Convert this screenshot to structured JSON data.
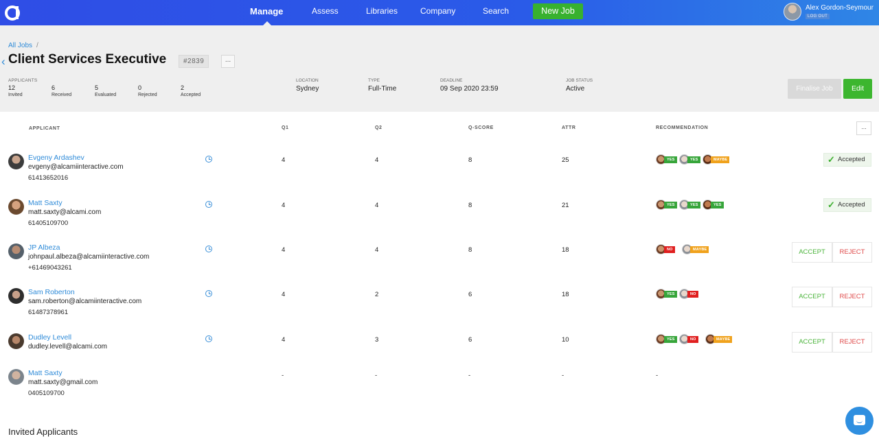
{
  "topbar": {
    "logo_icon": "alcami-logo-icon",
    "nav": [
      "Manage",
      "Assess",
      "Libraries",
      "Company",
      "Search"
    ],
    "active_nav": "Manage",
    "new_job_label": "New Job",
    "user_name": "Alex Gordon-Seymour",
    "logout_label": "LOG OUT"
  },
  "job": {
    "breadcrumb_root": "All Jobs",
    "breadcrumb_sep": "/",
    "title": "Client Services Executive",
    "id": "#2839",
    "more_label": "...",
    "applicants_label": "APPLICANTS",
    "stats": [
      {
        "n": "12",
        "label": "Invited"
      },
      {
        "n": "6",
        "label": "Received"
      },
      {
        "n": "5",
        "label": "Evaluated"
      },
      {
        "n": "0",
        "label": "Rejected"
      },
      {
        "n": "2",
        "label": "Accepted"
      }
    ],
    "meta": [
      {
        "label": "LOCATION",
        "value": "Sydney"
      },
      {
        "label": "TYPE",
        "value": "Full-Time"
      },
      {
        "label": "DEADLINE",
        "value": "09 Sep 2020 23:59"
      },
      {
        "label": "JOB STATUS",
        "value": "Active"
      }
    ],
    "finalise_label": "Finalise Job",
    "edit_label": "Edit"
  },
  "table": {
    "headers": {
      "applicant": "APPLICANT",
      "q1": "Q1",
      "q2": "Q2",
      "qscore": "Q-SCORE",
      "attr": "ATTR",
      "recommendation": "RECOMMENDATION"
    },
    "more_label": "...",
    "accepted_label": "Accepted",
    "accept_label": "ACCEPT",
    "reject_label": "REJECT",
    "rows": [
      {
        "name": "Evgeny Ardashev",
        "email": "evgeny@alcamiinteractive.com",
        "phone": "61413652016",
        "q1": "4",
        "q2": "4",
        "qscore": "8",
        "attr": "25",
        "recs": [
          {
            "label": "YES",
            "kind": "yes"
          },
          {
            "label": "YES",
            "kind": "yes"
          },
          {
            "label": "MAYBE",
            "kind": "maybe"
          }
        ],
        "status": "accepted"
      },
      {
        "name": "Matt Saxty",
        "email": "matt.saxty@alcami.com",
        "phone": "61405109700",
        "q1": "4",
        "q2": "4",
        "qscore": "8",
        "attr": "21",
        "recs": [
          {
            "label": "YES",
            "kind": "yes"
          },
          {
            "label": "YES",
            "kind": "yes"
          },
          {
            "label": "YES",
            "kind": "yes"
          }
        ],
        "status": "accepted"
      },
      {
        "name": "JP Albeza",
        "email": "johnpaul.albeza@alcamiinteractive.com",
        "phone": "+61469043261",
        "q1": "4",
        "q2": "4",
        "qscore": "8",
        "attr": "18",
        "recs": [
          {
            "label": "NO",
            "kind": "no"
          },
          {
            "label": "MAYBE",
            "kind": "maybe"
          }
        ],
        "status": "pending"
      },
      {
        "name": "Sam Roberton",
        "email": "sam.roberton@alcamiinteractive.com",
        "phone": "61487378961",
        "q1": "4",
        "q2": "2",
        "qscore": "6",
        "attr": "18",
        "recs": [
          {
            "label": "YES",
            "kind": "yes"
          },
          {
            "label": "NO",
            "kind": "no"
          }
        ],
        "status": "pending"
      },
      {
        "name": "Dudley Levell",
        "email": "dudley.levell@alcami.com",
        "phone": "",
        "q1": "4",
        "q2": "3",
        "qscore": "6",
        "attr": "10",
        "recs": [
          {
            "label": "YES",
            "kind": "yes"
          },
          {
            "label": "NO",
            "kind": "no"
          },
          {
            "label": "MAYBE",
            "kind": "maybe"
          }
        ],
        "status": "pending"
      },
      {
        "name": "Matt Saxty",
        "email": "matt.saxty@gmail.com",
        "phone": "0405109700",
        "q1": "-",
        "q2": "-",
        "qscore": "-",
        "attr": "-",
        "recs_placeholder": "-",
        "status": "none"
      }
    ]
  },
  "invited_title": "Invited Applicants",
  "colors": {
    "accent_blue": "#2f4de6",
    "link": "#2d8ad8",
    "green": "#38b12f",
    "red": "#e01f1f",
    "orange": "#f0a21c"
  }
}
